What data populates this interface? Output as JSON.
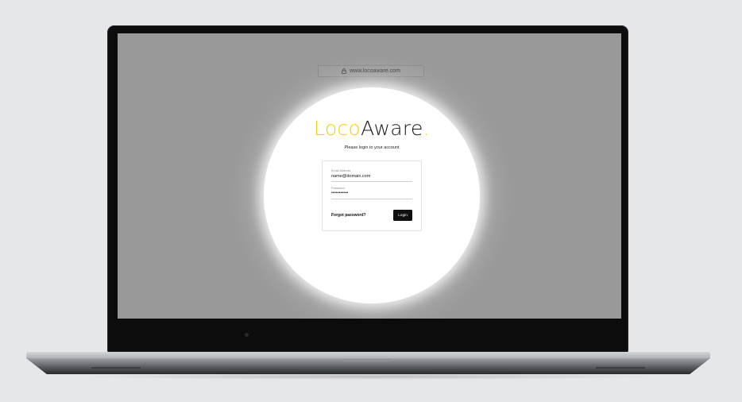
{
  "browser": {
    "url": "www.locoaware.com",
    "lock_icon": "lock-icon"
  },
  "brand": {
    "logo_part1": "Loco",
    "logo_part2": "Aware",
    "logo_dot": ".",
    "accent_color": "#f5d000"
  },
  "login": {
    "subtitle": "Please login to your account",
    "email_label": "Email Address",
    "email_value": "name@domain.com",
    "password_label": "Password",
    "password_value": "•••••••••••",
    "forgot_label": "Forgot password?",
    "login_button": "Login"
  }
}
